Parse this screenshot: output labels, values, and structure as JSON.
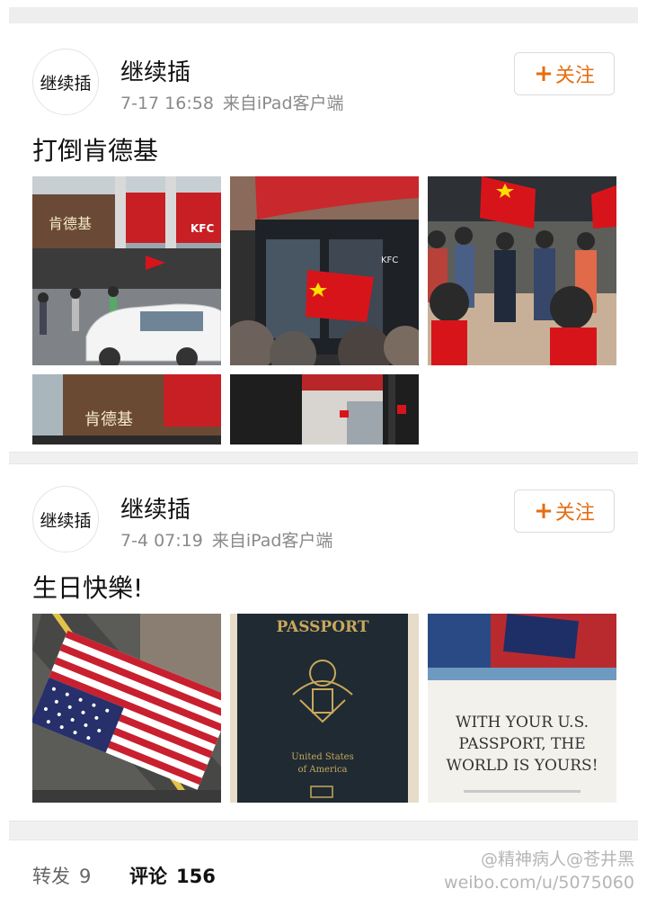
{
  "posts": [
    {
      "avatar_text": "继续插",
      "username": "继续插",
      "time": "7-17 16:58",
      "source": "来自iPad客户端",
      "follow_label": "关注",
      "text": "打倒肯德基",
      "photos": [
        {
          "caption_sign": "肯德基",
          "sign2": "KFC"
        },
        {
          "sign": "KFC"
        },
        {},
        {
          "caption_sign": "肯德基"
        },
        {}
      ]
    },
    {
      "avatar_text": "继续插",
      "username": "继续插",
      "time": "7-4 07:19",
      "source": "来自iPad客户端",
      "follow_label": "关注",
      "text": "生日快樂!",
      "photos": [
        {},
        {
          "title": "PASSPORT",
          "line1": "United States",
          "line2": "of America"
        },
        {
          "line1": "WITH YOUR U.S.",
          "line2": "PASSPORT, THE",
          "line3": "WORLD IS YOURS!"
        }
      ]
    }
  ],
  "footer": {
    "repost_label": "转发",
    "repost_count": "9",
    "comment_label": "评论",
    "comment_count": "156"
  },
  "watermark": {
    "line1": "@精神病人@苍井黑",
    "line2": "weibo.com/u/5075060"
  },
  "colors": {
    "accent": "#e66d10",
    "flag_red": "#d8141b",
    "star_yellow": "#ffde00"
  }
}
